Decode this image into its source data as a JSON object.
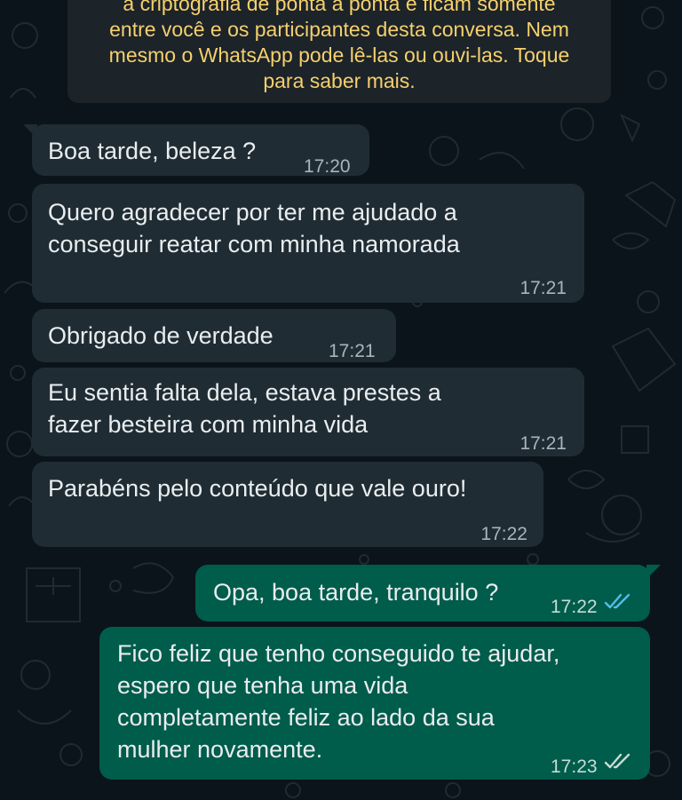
{
  "encryption_notice": {
    "lines": [
      "a criptografia de ponta a ponta e ficam somente",
      "entre você e os participantes desta conversa. Nem",
      "mesmo o WhatsApp pode lê-las ou ouvi-las. Toque",
      "para saber mais."
    ]
  },
  "messages": [
    {
      "direction": "incoming",
      "lines": [
        "Boa tarde, beleza ?"
      ],
      "time": "17:20"
    },
    {
      "direction": "incoming",
      "lines": [
        "Quero agradecer por ter me ajudado a",
        "conseguir reatar com minha namorada"
      ],
      "time": "17:21"
    },
    {
      "direction": "incoming",
      "lines": [
        "Obrigado de verdade"
      ],
      "time": "17:21"
    },
    {
      "direction": "incoming",
      "lines": [
        "Eu sentia falta dela, estava prestes a",
        "fazer besteira com minha vida"
      ],
      "time": "17:21"
    },
    {
      "direction": "incoming",
      "lines": [
        "Parabéns pelo conteúdo que vale ouro!"
      ],
      "time": "17:22"
    },
    {
      "direction": "outgoing",
      "lines": [
        "Opa, boa tarde, tranquilo ?"
      ],
      "time": "17:22",
      "status": "read",
      "status_icon": "double-check-icon",
      "status_color": "#53bdeb"
    },
    {
      "direction": "outgoing",
      "lines": [
        "Fico feliz que tenho conseguido te ajudar,",
        "espero que tenha uma vida",
        "completamente feliz ao lado da sua",
        "mulher novamente."
      ],
      "time": "17:23",
      "status": "delivered",
      "status_icon": "double-check-icon",
      "status_color": "#c7dcd6"
    }
  ],
  "colors": {
    "background": "#0b141a",
    "incoming_bubble": "#1f2c34",
    "outgoing_bubble": "#005c4b",
    "notice_text": "#f5d06d",
    "read_ticks": "#53bdeb"
  }
}
